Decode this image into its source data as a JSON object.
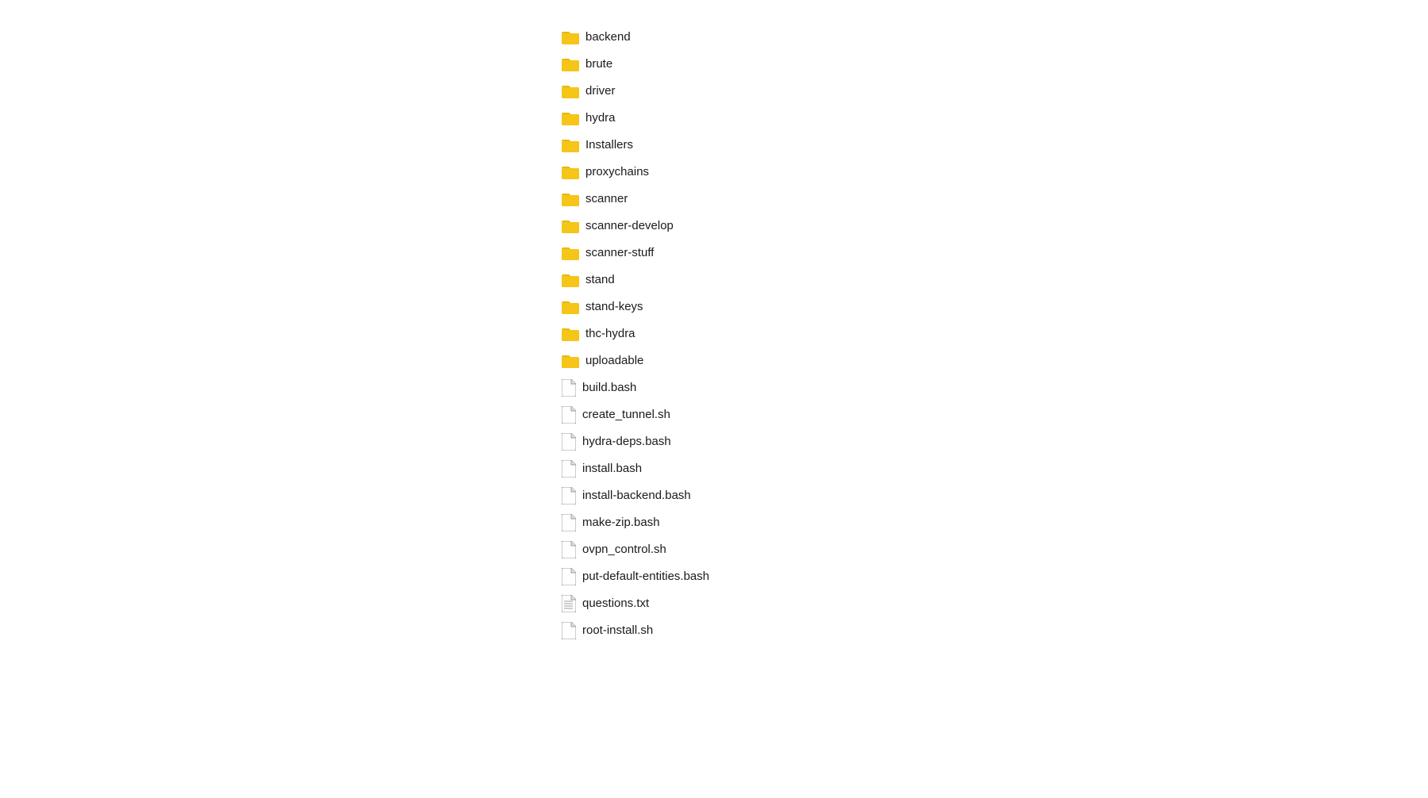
{
  "fileList": {
    "items": [
      {
        "name": "backend",
        "type": "folder"
      },
      {
        "name": "brute",
        "type": "folder"
      },
      {
        "name": "driver",
        "type": "folder"
      },
      {
        "name": "hydra",
        "type": "folder"
      },
      {
        "name": "Installers",
        "type": "folder"
      },
      {
        "name": "proxychains",
        "type": "folder"
      },
      {
        "name": "scanner",
        "type": "folder"
      },
      {
        "name": "scanner-develop",
        "type": "folder"
      },
      {
        "name": "scanner-stuff",
        "type": "folder"
      },
      {
        "name": "stand",
        "type": "folder"
      },
      {
        "name": "stand-keys",
        "type": "folder"
      },
      {
        "name": "thc-hydra",
        "type": "folder"
      },
      {
        "name": "uploadable",
        "type": "folder"
      },
      {
        "name": "build.bash",
        "type": "file"
      },
      {
        "name": "create_tunnel.sh",
        "type": "file"
      },
      {
        "name": "hydra-deps.bash",
        "type": "file"
      },
      {
        "name": "install.bash",
        "type": "file"
      },
      {
        "name": "install-backend.bash",
        "type": "file"
      },
      {
        "name": "make-zip.bash",
        "type": "file"
      },
      {
        "name": "ovpn_control.sh",
        "type": "file"
      },
      {
        "name": "put-default-entities.bash",
        "type": "file"
      },
      {
        "name": "questions.txt",
        "type": "file-text"
      },
      {
        "name": "root-install.sh",
        "type": "file"
      }
    ]
  },
  "colors": {
    "folder": "#f5c842",
    "file": "#ffffff",
    "fileBorder": "#9e9e9e",
    "text": "#1a1a1a",
    "background": "#ffffff"
  }
}
